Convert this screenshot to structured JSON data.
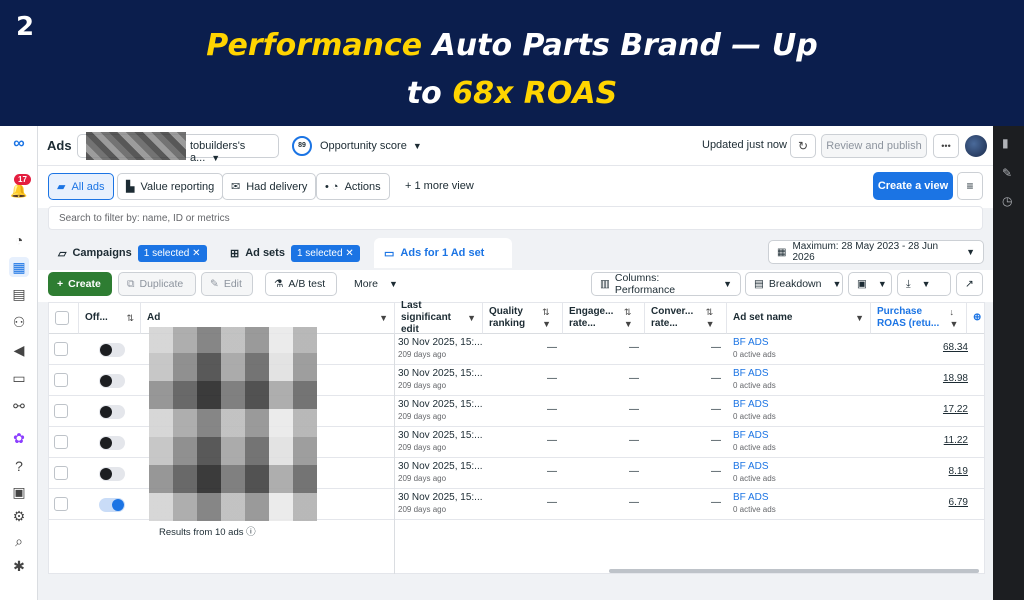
{
  "banner": {
    "slide_number": "2",
    "headline_highlight_1": "Performance",
    "headline_rest_1": " Auto Parts Brand — Up",
    "headline_pre_2": "to ",
    "headline_highlight_2": "68x ROAS",
    "colors": {
      "background": "#0b1e4d",
      "highlight": "#ffd400"
    }
  },
  "rail": {
    "notification_count": "17",
    "icons": [
      "meta-logo-icon",
      "notification-icon",
      "dashboard-icon",
      "table-icon",
      "pages-icon",
      "audience-icon",
      "megaphone-icon",
      "billing-icon",
      "connections-icon",
      "ai-sparkle-icon",
      "help-icon",
      "news-icon",
      "settings-icon",
      "search-icon",
      "bug-icon"
    ]
  },
  "topbar": {
    "title": "Ads",
    "account_name": "tobuilders's a...",
    "opportunity_score_value": "89",
    "opportunity_label": "Opportunity score",
    "updated_text": "Updated just now",
    "review_publish_label": "Review and publish",
    "more_label": "•••"
  },
  "tabs": {
    "items": [
      {
        "label": "All ads",
        "icon": "folder-icon",
        "active": true
      },
      {
        "label": "Value reporting",
        "icon": "report-icon",
        "active": false
      },
      {
        "label": "Had delivery",
        "icon": "envelope-icon",
        "active": false
      },
      {
        "label": "Actions",
        "icon": "actions-icon",
        "active": false
      }
    ],
    "more_views": "1 more view",
    "create_view_label": "Create a view"
  },
  "search": {
    "placeholder": "Search to filter by: name, ID or metrics"
  },
  "levels": {
    "campaigns_label": "Campaigns",
    "campaigns_selected": "1 selected",
    "adsets_label": "Ad sets",
    "adsets_selected": "1 selected",
    "ads_label": "Ads for 1 Ad set",
    "date_range": "Maximum: 28 May 2023 - 28 Jun 2026"
  },
  "toolbar": {
    "create_label": "Create",
    "duplicate_label": "Duplicate",
    "edit_label": "Edit",
    "abtest_label": "A/B test",
    "more_label": "More",
    "columns_label": "Columns: Performance",
    "breakdown_label": "Breakdown"
  },
  "table": {
    "headers": {
      "off": "Off...",
      "ad": "Ad",
      "last_edit": "Last significant edit",
      "quality": "Quality ranking",
      "engagement": "Engage... rate...",
      "conversion": "Conver... rate...",
      "adset": "Ad set name",
      "roas": "Purchase ROAS (retu..."
    },
    "rows": [
      {
        "on": false,
        "edit_date": "30 Nov 2025, 15:...",
        "edit_ago": "209 days ago",
        "quality": "—",
        "engagement": "—",
        "conversion": "—",
        "adset": "BF ADS",
        "adset_status": "0 active ads",
        "roas": "68.34"
      },
      {
        "on": false,
        "edit_date": "30 Nov 2025, 15:...",
        "edit_ago": "209 days ago",
        "quality": "—",
        "engagement": "—",
        "conversion": "—",
        "adset": "BF ADS",
        "adset_status": "0 active ads",
        "roas": "18.98"
      },
      {
        "on": false,
        "edit_date": "30 Nov 2025, 15:...",
        "edit_ago": "209 days ago",
        "quality": "—",
        "engagement": "—",
        "conversion": "—",
        "adset": "BF ADS",
        "adset_status": "0 active ads",
        "roas": "17.22"
      },
      {
        "on": false,
        "edit_date": "30 Nov 2025, 15:...",
        "edit_ago": "209 days ago",
        "quality": "—",
        "engagement": "—",
        "conversion": "—",
        "adset": "BF ADS",
        "adset_status": "0 active ads",
        "roas": "11.22"
      },
      {
        "on": false,
        "edit_date": "30 Nov 2025, 15:...",
        "edit_ago": "209 days ago",
        "quality": "—",
        "engagement": "—",
        "conversion": "—",
        "adset": "BF ADS",
        "adset_status": "0 active ads",
        "roas": "8.19"
      },
      {
        "on": true,
        "edit_date": "30 Nov 2025, 15:...",
        "edit_ago": "209 days ago",
        "quality": "—",
        "engagement": "—",
        "conversion": "—",
        "adset": "BF ADS",
        "adset_status": "0 active ads",
        "roas": "6.79"
      }
    ],
    "results_text": "Results from 10 ads"
  }
}
